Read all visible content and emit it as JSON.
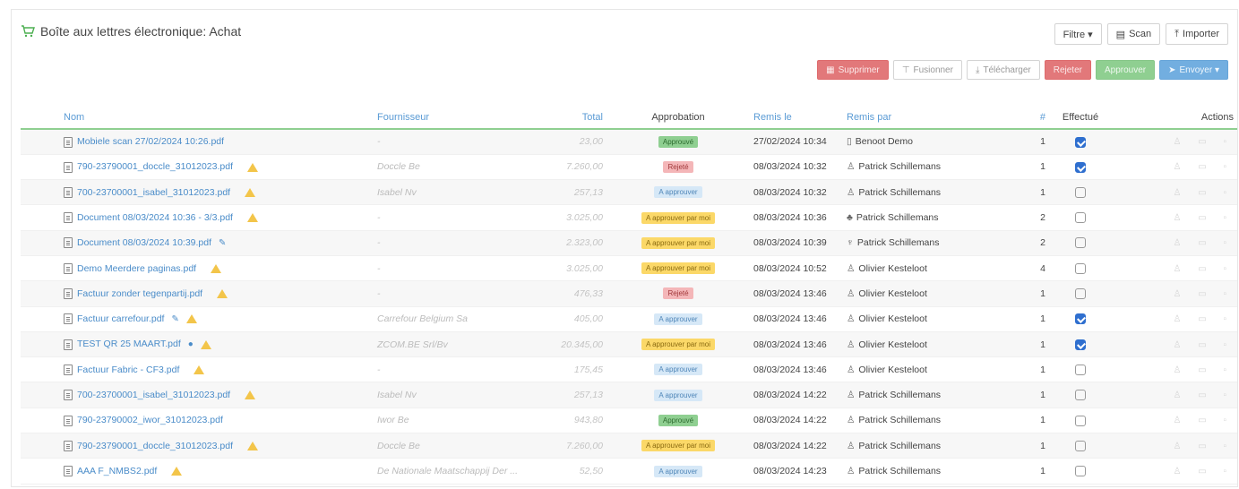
{
  "title": "Boîte aux lettres électronique: Achat",
  "top_buttons": {
    "filter": "Filtre ▾",
    "scan": "Scan",
    "import": "Importer"
  },
  "action_buttons": {
    "delete": "Supprimer",
    "merge": "Fusionner",
    "download": "Télécharger",
    "reject": "Rejeter",
    "approve": "Approuver",
    "send": "Envoyer ▾"
  },
  "columns": {
    "name": "Nom",
    "supplier": "Fournisseur",
    "total": "Total",
    "approval": "Approbation",
    "submitted_on": "Remis le",
    "submitted_by": "Remis par",
    "count": "#",
    "done": "Effectué",
    "actions": "Actions"
  },
  "rows": [
    {
      "name": "Mobiele scan 27/02/2024 10:26.pdf",
      "warn": false,
      "tag": "",
      "supplier": "-",
      "total": "23,00",
      "status": "Approuvé",
      "status_type": "green",
      "date": "27/02/2024 10:34",
      "user_icon": "▯",
      "user": "Benoot Demo",
      "count": "1",
      "done": true
    },
    {
      "name": "790-23790001_doccle_31012023.pdf",
      "warn": true,
      "tag": "",
      "supplier": "Doccle Be",
      "total": "7.260,00",
      "status": "Rejeté",
      "status_type": "red",
      "date": "08/03/2024 10:32",
      "user_icon": "♙",
      "user": "Patrick Schillemans",
      "count": "1",
      "done": true
    },
    {
      "name": "700-23700001_isabel_31012023.pdf",
      "warn": true,
      "tag": "",
      "supplier": "Isabel Nv",
      "total": "257,13",
      "status": "A approuver",
      "status_type": "blue",
      "date": "08/03/2024 10:32",
      "user_icon": "♙",
      "user": "Patrick Schillemans",
      "count": "1",
      "done": false
    },
    {
      "name": "Document 08/03/2024 10:36 - 3/3.pdf",
      "warn": true,
      "tag": "",
      "supplier": "-",
      "total": "3.025,00",
      "status": "A approuver par moi",
      "status_type": "yellow",
      "date": "08/03/2024 10:36",
      "user_icon": "♣",
      "user": "Patrick Schillemans",
      "count": "2",
      "done": false
    },
    {
      "name": "Document 08/03/2024 10:39.pdf",
      "warn": false,
      "tag": "✎",
      "supplier": "-",
      "total": "2.323,00",
      "status": "A approuver par moi",
      "status_type": "yellow",
      "date": "08/03/2024 10:39",
      "user_icon": "♆",
      "user": "Patrick Schillemans",
      "count": "2",
      "done": false
    },
    {
      "name": "Demo Meerdere paginas.pdf",
      "warn": true,
      "tag": "",
      "supplier": "-",
      "total": "3.025,00",
      "status": "A approuver par moi",
      "status_type": "yellow",
      "date": "08/03/2024 10:52",
      "user_icon": "♙",
      "user": "Olivier Kesteloot",
      "count": "4",
      "done": false
    },
    {
      "name": "Factuur zonder tegenpartij.pdf",
      "warn": true,
      "tag": "",
      "supplier": "-",
      "total": "476,33",
      "status": "Rejeté",
      "status_type": "red",
      "date": "08/03/2024 13:46",
      "user_icon": "♙",
      "user": "Olivier Kesteloot",
      "count": "1",
      "done": false
    },
    {
      "name": "Factuur carrefour.pdf",
      "warn": true,
      "tag": "✎",
      "supplier": "Carrefour Belgium Sa",
      "total": "405,00",
      "status": "A approuver",
      "status_type": "blue",
      "date": "08/03/2024 13:46",
      "user_icon": "♙",
      "user": "Olivier Kesteloot",
      "count": "1",
      "done": true
    },
    {
      "name": "TEST QR 25 MAART.pdf",
      "warn": true,
      "tag": "●",
      "supplier": "ZCOM.BE Srl/Bv",
      "total": "20.345,00",
      "status": "A approuver par moi",
      "status_type": "yellow",
      "date": "08/03/2024 13:46",
      "user_icon": "♙",
      "user": "Olivier Kesteloot",
      "count": "1",
      "done": true
    },
    {
      "name": "Factuur Fabric - CF3.pdf",
      "warn": true,
      "tag": "",
      "supplier": "-",
      "total": "175,45",
      "status": "A approuver",
      "status_type": "blue",
      "date": "08/03/2024 13:46",
      "user_icon": "♙",
      "user": "Olivier Kesteloot",
      "count": "1",
      "done": false
    },
    {
      "name": "700-23700001_isabel_31012023.pdf",
      "warn": true,
      "tag": "",
      "supplier": "Isabel Nv",
      "total": "257,13",
      "status": "A approuver",
      "status_type": "blue",
      "date": "08/03/2024 14:22",
      "user_icon": "♙",
      "user": "Patrick Schillemans",
      "count": "1",
      "done": false
    },
    {
      "name": "790-23790002_iwor_31012023.pdf",
      "warn": false,
      "tag": "",
      "supplier": "Iwor Be",
      "total": "943,80",
      "status": "Approuvé",
      "status_type": "green",
      "date": "08/03/2024 14:22",
      "user_icon": "♙",
      "user": "Patrick Schillemans",
      "count": "1",
      "done": false
    },
    {
      "name": "790-23790001_doccle_31012023.pdf",
      "warn": true,
      "tag": "",
      "supplier": "Doccle Be",
      "total": "7.260,00",
      "status": "A approuver par moi",
      "status_type": "yellow",
      "date": "08/03/2024 14:22",
      "user_icon": "♙",
      "user": "Patrick Schillemans",
      "count": "1",
      "done": false
    },
    {
      "name": "AAA F_NMBS2.pdf",
      "warn": true,
      "tag": "",
      "supplier": "De Nationale Maatschappij Der ...",
      "total": "52,50",
      "status": "A approuver",
      "status_type": "blue",
      "date": "08/03/2024 14:23",
      "user_icon": "♙",
      "user": "Patrick Schillemans",
      "count": "1",
      "done": false
    }
  ]
}
